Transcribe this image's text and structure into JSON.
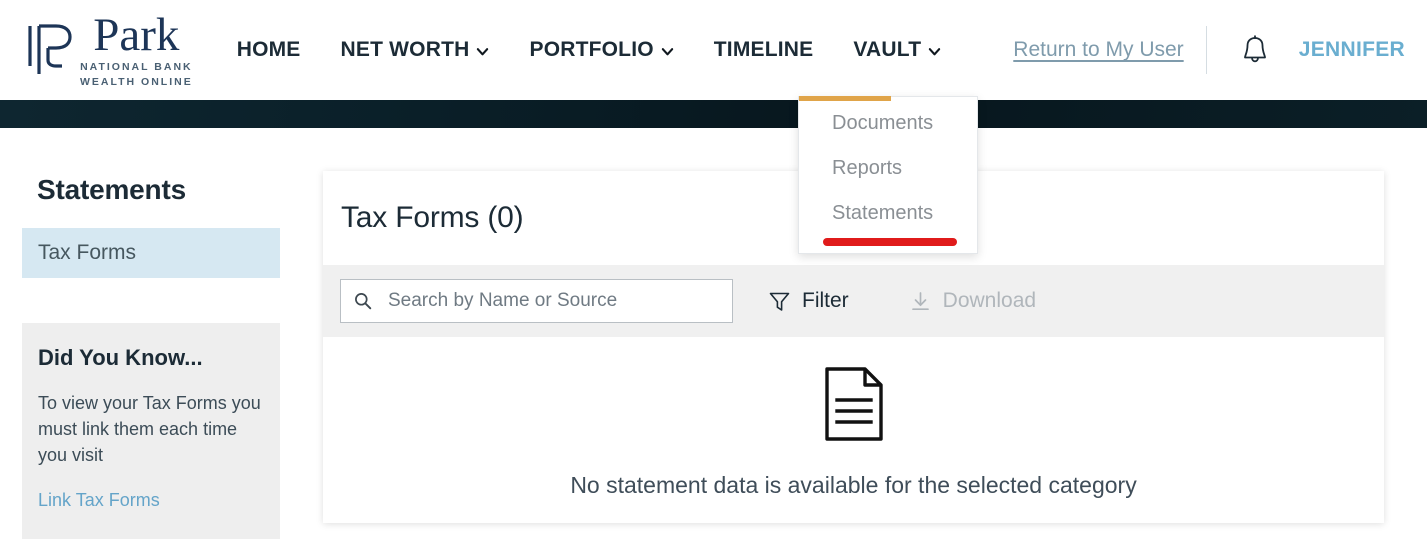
{
  "brand": {
    "name": "Park",
    "line1": "NATIONAL BANK",
    "line2": "WEALTH ONLINE",
    "logo_icon": "park-p-mark-icon"
  },
  "nav": {
    "items": [
      {
        "label": "HOME",
        "has_caret": false
      },
      {
        "label": "NET WORTH",
        "has_caret": true
      },
      {
        "label": "PORTFOLIO",
        "has_caret": true
      },
      {
        "label": "TIMELINE",
        "has_caret": false
      },
      {
        "label": "VAULT",
        "has_caret": true
      }
    ],
    "return_link": "Return to My User",
    "notification_icon": "bell-icon",
    "user_name": "JENNIFER"
  },
  "vault_dropdown": {
    "accent_color": "#e0a449",
    "items": [
      {
        "label": "Documents"
      },
      {
        "label": "Reports"
      },
      {
        "label": "Statements"
      }
    ],
    "annotation_color": "#e01b1b"
  },
  "sidebar": {
    "title": "Statements",
    "items": [
      {
        "label": "Tax Forms",
        "selected": true
      }
    ],
    "info_card": {
      "title": "Did You Know...",
      "body": "To view your Tax Forms you must link them each time you visit",
      "link": "Link Tax Forms"
    }
  },
  "panel": {
    "title": "Tax Forms (0)",
    "search": {
      "placeholder": "Search by Name or Source",
      "value": "",
      "icon": "search-icon"
    },
    "filter": {
      "label": "Filter",
      "icon": "funnel-icon",
      "disabled": false
    },
    "download": {
      "label": "Download",
      "icon": "download-icon",
      "disabled": true
    },
    "empty_state": {
      "icon": "document-lines-icon",
      "message": "No statement data is available for the selected category"
    }
  },
  "colors": {
    "banner": "#0a1f28",
    "accent_gold": "#e0a449",
    "annotation_red": "#e01b1b",
    "user_blue": "#6aaed0",
    "selected_item_bg": "#d6e8f2"
  }
}
